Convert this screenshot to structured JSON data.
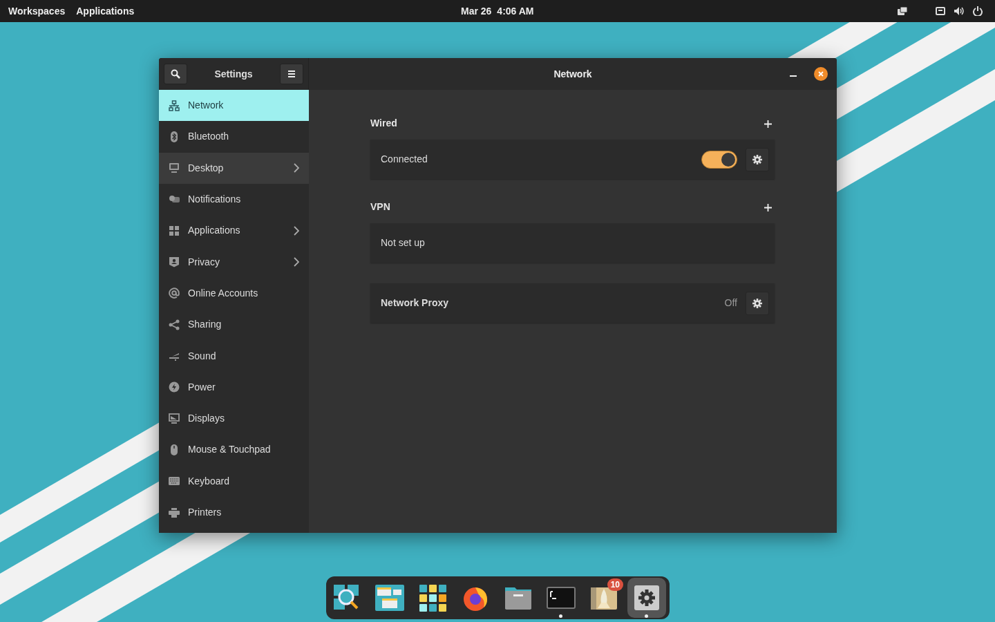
{
  "top_bar": {
    "left": [
      "Workspaces",
      "Applications"
    ],
    "date": "Mar 26",
    "time": "4:06 AM"
  },
  "window": {
    "sidebar_title": "Settings",
    "title": "Network"
  },
  "sidebar": {
    "items": [
      {
        "label": "Network",
        "selected": true,
        "hovered": false,
        "expandable": false
      },
      {
        "label": "Bluetooth",
        "selected": false,
        "hovered": false,
        "expandable": false
      },
      {
        "label": "Desktop",
        "selected": false,
        "hovered": true,
        "expandable": true
      },
      {
        "label": "Notifications",
        "selected": false,
        "hovered": false,
        "expandable": false
      },
      {
        "label": "Applications",
        "selected": false,
        "hovered": false,
        "expandable": true
      },
      {
        "label": "Privacy",
        "selected": false,
        "hovered": false,
        "expandable": true
      },
      {
        "label": "Online Accounts",
        "selected": false,
        "hovered": false,
        "expandable": false
      },
      {
        "label": "Sharing",
        "selected": false,
        "hovered": false,
        "expandable": false
      },
      {
        "label": "Sound",
        "selected": false,
        "hovered": false,
        "expandable": false
      },
      {
        "label": "Power",
        "selected": false,
        "hovered": false,
        "expandable": false
      },
      {
        "label": "Displays",
        "selected": false,
        "hovered": false,
        "expandable": false
      },
      {
        "label": "Mouse & Touchpad",
        "selected": false,
        "hovered": false,
        "expandable": false
      },
      {
        "label": "Keyboard",
        "selected": false,
        "hovered": false,
        "expandable": false
      },
      {
        "label": "Printers",
        "selected": false,
        "hovered": false,
        "expandable": false
      }
    ]
  },
  "sections": [
    {
      "title": "Wired",
      "rows": [
        {
          "kind": "toggle",
          "label": "Connected",
          "on": true
        }
      ]
    },
    {
      "title": "VPN",
      "rows": [
        {
          "kind": "plain",
          "label": "Not set up"
        }
      ]
    },
    {
      "rows": [
        {
          "kind": "proxy",
          "label": "Network Proxy",
          "value": "Off"
        }
      ]
    }
  ],
  "dock": {
    "items": [
      {
        "running": false,
        "active": false
      },
      {
        "running": false,
        "active": false
      },
      {
        "running": false,
        "active": false
      },
      {
        "running": false,
        "active": false
      },
      {
        "running": false,
        "active": false
      },
      {
        "running": true,
        "active": false
      },
      {
        "running": false,
        "active": false,
        "badge": "10"
      },
      {
        "running": true,
        "active": true
      }
    ]
  }
}
